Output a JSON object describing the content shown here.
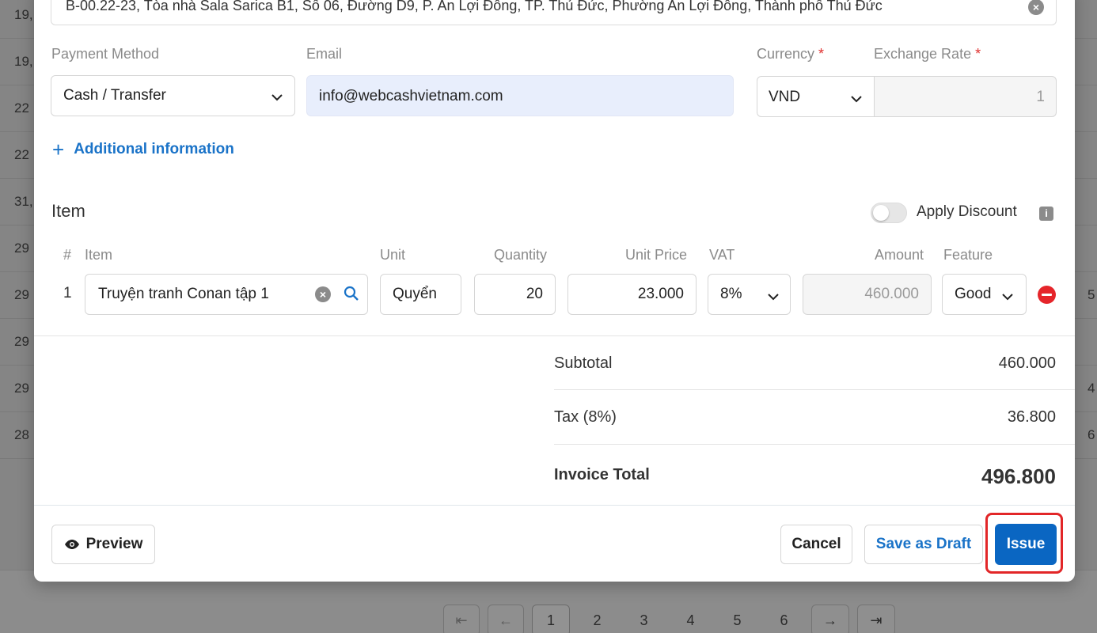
{
  "background": {
    "left_cells": [
      "19,",
      "19,",
      "22",
      "22",
      "31,",
      "29",
      "29",
      "29",
      "29",
      "28"
    ],
    "right_cells": [
      "",
      "",
      "",
      "",
      "",
      "",
      "5",
      "",
      "4",
      "6"
    ],
    "pager": {
      "first": "⇤",
      "prev": "←",
      "pages": [
        "1",
        "2",
        "3",
        "4",
        "5",
        "6"
      ],
      "next": "→",
      "last": "⇥"
    }
  },
  "modal": {
    "address": "B-00.22-23, Tòa nhà Sala Sarica B1, Số 06, Đường D9, P. An Lợi Đông, TP. Thủ Đức, Phường An Lợi Đông, Thành phố Thủ Đức",
    "payment_method": {
      "label": "Payment Method",
      "value": "Cash / Transfer"
    },
    "email": {
      "label": "Email",
      "value": "info@webcashvietnam.com"
    },
    "currency": {
      "label": "Currency",
      "required_mark": "*",
      "value": "VND"
    },
    "exchange_rate": {
      "label": "Exchange Rate",
      "required_mark": "*",
      "value": "1"
    },
    "additional_info": {
      "icon": "+",
      "label": "Additional information"
    },
    "items_section": {
      "title": "Item",
      "apply_discount_label": "Apply Discount",
      "apply_discount_on": false,
      "info_icon": "i",
      "columns": {
        "num": "#",
        "item": "Item",
        "unit": "Unit",
        "quantity": "Quantity",
        "unit_price": "Unit Price",
        "vat": "VAT",
        "amount": "Amount",
        "feature": "Feature"
      },
      "rows": [
        {
          "num": "1",
          "item": "Truyện tranh Conan tập 1",
          "unit": "Quyển",
          "quantity": "20",
          "unit_price": "23.000",
          "vat": "8%",
          "amount": "460.000",
          "feature": "Good"
        }
      ]
    },
    "summary": {
      "subtotal_label": "Subtotal",
      "subtotal_value": "460.000",
      "tax_label": "Tax (8%)",
      "tax_value": "36.800",
      "total_label": "Invoice Total",
      "total_value": "496.800"
    },
    "footer": {
      "preview_label": "Preview",
      "cancel_label": "Cancel",
      "draft_label": "Save as Draft",
      "issue_label": "Issue"
    }
  },
  "colors": {
    "accent": "#0a66c2",
    "link": "#1a73c8",
    "danger": "#e5252a",
    "highlight": "#e22628",
    "email_bg": "#e8eefc"
  }
}
